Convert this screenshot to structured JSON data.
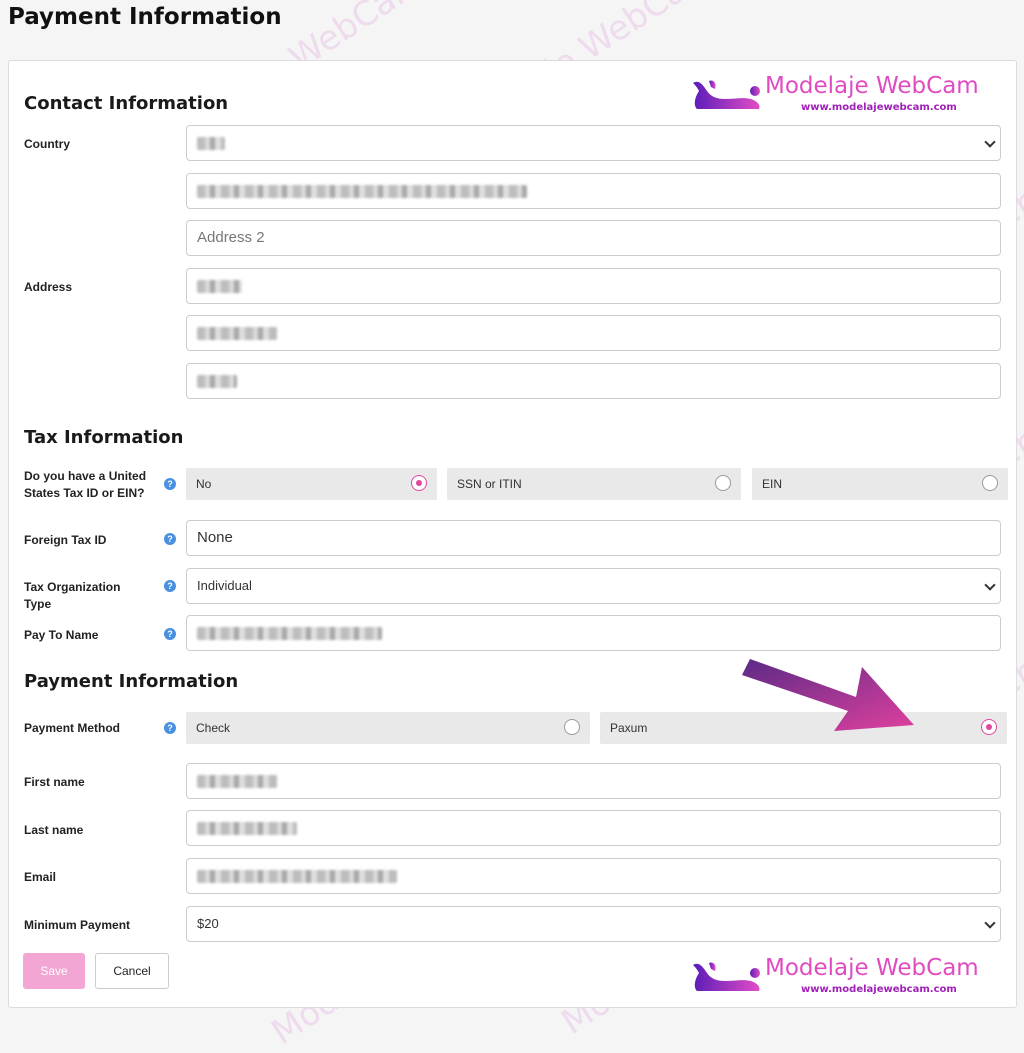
{
  "page_title": "Payment Information",
  "brand": {
    "name": "Modelaje WebCam",
    "url": "www.modelajewebcam.com",
    "color": "#e04cc0",
    "watermark_text": "Modelaje WebCam",
    "watermark_url": "www.modelajewebcam.com"
  },
  "contact": {
    "heading": "Contact Information",
    "country_label": "Country",
    "address_label": "Address",
    "address2_placeholder": "Address 2"
  },
  "tax": {
    "heading": "Tax Information",
    "us_tax_label": "Do you have a United States Tax ID or EIN?",
    "us_tax_options": [
      {
        "label": "No",
        "checked": true
      },
      {
        "label": "SSN or ITIN",
        "checked": false
      },
      {
        "label": "EIN",
        "checked": false
      }
    ],
    "foreign_tax_label": "Foreign Tax ID",
    "foreign_tax_value": "None",
    "org_type_label": "Tax Organization Type",
    "org_type_value": "Individual",
    "pay_to_label": "Pay To Name"
  },
  "payment": {
    "heading": "Payment Information",
    "method_label": "Payment Method",
    "method_options": [
      {
        "label": "Check",
        "checked": false
      },
      {
        "label": "Paxum",
        "checked": true
      }
    ],
    "first_name_label": "First name",
    "last_name_label": "Last name",
    "email_label": "Email",
    "min_payment_label": "Minimum Payment",
    "min_payment_value": "$20"
  },
  "buttons": {
    "save": "Save",
    "cancel": "Cancel"
  },
  "help_glyph": "?",
  "accent_color": "#e0479e"
}
